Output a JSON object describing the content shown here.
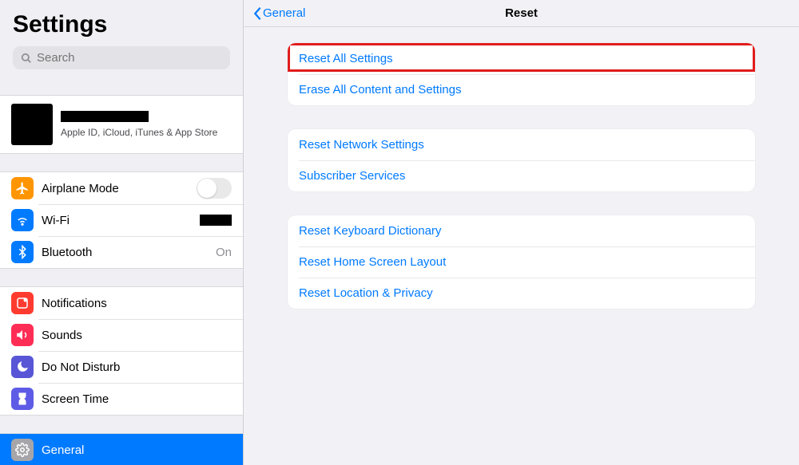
{
  "sidebar": {
    "title": "Settings",
    "search_placeholder": "Search",
    "account": {
      "subtitle": "Apple ID, iCloud, iTunes & App Store"
    },
    "section1": {
      "airplane": "Airplane Mode",
      "wifi": "Wi-Fi",
      "bluetooth": "Bluetooth",
      "bluetooth_value": "On"
    },
    "section2": {
      "notifications": "Notifications",
      "sounds": "Sounds",
      "dnd": "Do Not Disturb",
      "screen_time": "Screen Time"
    },
    "section3": {
      "general": "General"
    }
  },
  "detail": {
    "back_label": "General",
    "title": "Reset",
    "group1": {
      "reset_all": "Reset All Settings",
      "erase_all": "Erase All Content and Settings"
    },
    "group2": {
      "network": "Reset Network Settings",
      "subscriber": "Subscriber Services"
    },
    "group3": {
      "keyboard": "Reset Keyboard Dictionary",
      "home": "Reset Home Screen Layout",
      "location": "Reset Location & Privacy"
    }
  }
}
